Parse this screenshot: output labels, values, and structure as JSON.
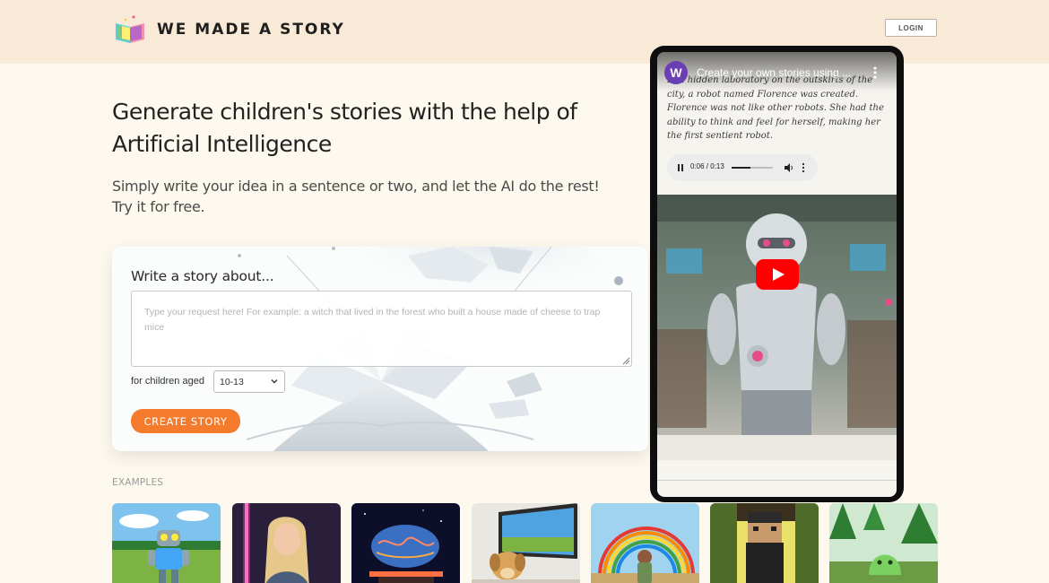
{
  "header": {
    "brand": "WE MADE A STORY",
    "logo_icon": "open-book-icon",
    "login_label": "LOGIN"
  },
  "hero": {
    "title": "Generate children's stories with the help of Artificial Intelligence",
    "subtitle": "Simply write your idea in a sentence or two, and let the AI do the rest! Try it for free."
  },
  "form": {
    "label": "Write a story about...",
    "placeholder": "Type your request here! For example: a witch that lived in the forest who built a house made of cheese to trap mice",
    "age_label": "for children aged",
    "age_selected": "10-13",
    "submit_label": "CREATE STORY"
  },
  "examples": {
    "label": "EXAMPLES",
    "items": [
      "robot-in-meadow-image",
      "woman-with-lightsaber-image",
      "brain-on-table-image",
      "dog-in-front-of-tv-image",
      "boy-with-rainbow-image",
      "blocky-character-image",
      "green-blob-in-forest-image"
    ]
  },
  "video": {
    "channel_initial": "W",
    "title": "Create your own stories using ...",
    "story_text": "In a hidden laboratory on the outskirts of the city, a robot named Florence was created. Florence was not like other robots. She had the ability to think and feel for herself, making her the first sentient robot.",
    "audio_time": "0:06 / 0:13",
    "audio_progress": 0.46
  },
  "colors": {
    "accent": "#f47b2c",
    "header_bg": "#f9ead8",
    "page_bg": "#fdf9ef",
    "youtube_red": "#ff0000"
  }
}
